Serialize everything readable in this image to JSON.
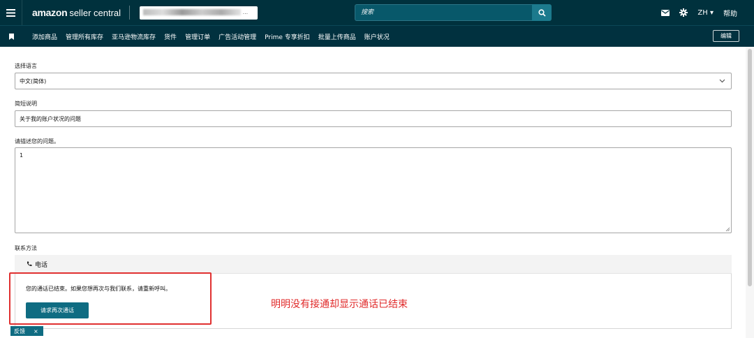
{
  "header": {
    "logo_amazon": "amazon",
    "logo_seller_central": "seller central",
    "store_text": "...",
    "search_placeholder": "搜索",
    "language": "ZH",
    "help": "帮助",
    "icons": [
      "menu-icon",
      "search-icon",
      "mail-icon",
      "gear-icon",
      "caret-down-icon"
    ]
  },
  "nav": {
    "items": [
      "添加商品",
      "管理所有库存",
      "亚马逊物流库存",
      "货件",
      "管理订单",
      "广告活动管理",
      "Prime 专享折扣",
      "批量上传商品",
      "账户状况"
    ],
    "edit": "编辑"
  },
  "form": {
    "language_label": "选择语言",
    "language_value": "中文(简体)",
    "summary_label": "简短说明",
    "summary_value": "关于我的账户状况的问题",
    "describe_label": "请描述您的问题。",
    "describe_value": "1",
    "contact_label": "联系方法",
    "contact_tab": "电话",
    "call_ended": "您的通话已结束。如果您想再次与我们联系，请重新呼叫。",
    "recall_button": "请求再次通话"
  },
  "annotation": {
    "text": "明明没有接通却显示通话已结束",
    "color": "#e02a2a"
  },
  "feedback": {
    "label": "反馈",
    "close": "×"
  },
  "colors": {
    "header_bg": "#00313d",
    "button_teal": "#0f6c82"
  }
}
